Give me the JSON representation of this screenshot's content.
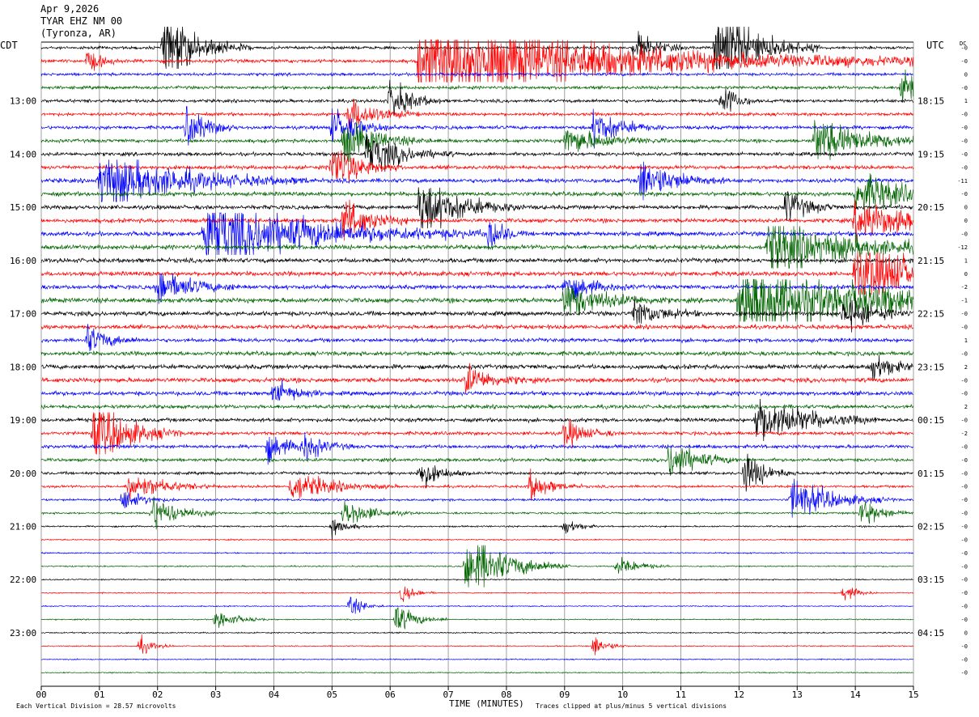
{
  "header": {
    "date": "Apr 9,2026",
    "station": "TYAR EHZ NM 00",
    "location": "(Tyronza, AR)"
  },
  "axis": {
    "left_zone": "CDT",
    "right_zone": "UTC",
    "dc_label": "DC",
    "xlabel": "TIME (MINUTES)"
  },
  "footer": {
    "scale_note": "Each Vertical Division =   28.57 microvolts",
    "clip_note": "Traces clipped at plus/minus 5 vertical divisions"
  },
  "chart_data": {
    "type": "line",
    "title": "TYAR EHZ NM 00",
    "xlabel": "TIME (MINUTES)",
    "xlim": [
      0,
      15
    ],
    "x_ticks": [
      "00",
      "01",
      "02",
      "03",
      "04",
      "05",
      "06",
      "07",
      "08",
      "09",
      "10",
      "11",
      "12",
      "13",
      "14",
      "15"
    ],
    "trace_colors": [
      "#000000",
      "#ff0000",
      "#0000ff",
      "#006400"
    ],
    "trace_count": 48,
    "left_ticks": [
      {
        "trace": 4,
        "label": "13:00"
      },
      {
        "trace": 8,
        "label": "14:00"
      },
      {
        "trace": 12,
        "label": "15:00"
      },
      {
        "trace": 16,
        "label": "16:00"
      },
      {
        "trace": 20,
        "label": "17:00"
      },
      {
        "trace": 24,
        "label": "18:00"
      },
      {
        "trace": 28,
        "label": "19:00"
      },
      {
        "trace": 32,
        "label": "20:00"
      },
      {
        "trace": 36,
        "label": "21:00"
      },
      {
        "trace": 40,
        "label": "22:00"
      },
      {
        "trace": 44,
        "label": "23:00"
      }
    ],
    "right_ticks": [
      {
        "trace": 4,
        "label": "18:15"
      },
      {
        "trace": 8,
        "label": "19:15"
      },
      {
        "trace": 12,
        "label": "20:15"
      },
      {
        "trace": 16,
        "label": "21:15"
      },
      {
        "trace": 20,
        "label": "22:15"
      },
      {
        "trace": 24,
        "label": "23:15"
      },
      {
        "trace": 28,
        "label": "00:15"
      },
      {
        "trace": 32,
        "label": "01:15"
      },
      {
        "trace": 36,
        "label": "02:15"
      },
      {
        "trace": 40,
        "label": "03:15"
      },
      {
        "trace": 44,
        "label": "04:15"
      }
    ],
    "dc_offsets": [
      "-0",
      "-0",
      "0",
      "-0",
      "1",
      "-0",
      "-0",
      "-0",
      "-0",
      "-0",
      "-11",
      "-0",
      "0",
      "0",
      "-0",
      "-12",
      "1",
      "0",
      "-2",
      "-1",
      "-0",
      "-0",
      "1",
      "-0",
      "2",
      "-0",
      "-0",
      "2",
      "-0",
      "-2",
      "-0",
      "-0",
      "-0",
      "-0",
      "-0",
      "-0",
      "-0",
      "-0",
      "-0",
      "-0",
      "-0",
      "-0",
      "-0",
      "-0",
      "0",
      "-0",
      "-0",
      "-0"
    ],
    "noise_level": [
      0.9,
      1.1,
      0.9,
      1.0,
      1.0,
      1.0,
      1.1,
      1.1,
      1.1,
      1.2,
      1.3,
      1.3,
      1.3,
      1.3,
      1.4,
      1.4,
      1.4,
      1.4,
      1.3,
      1.5,
      1.4,
      1.3,
      1.2,
      1.3,
      1.4,
      1.4,
      1.3,
      1.2,
      1.2,
      1.1,
      1.1,
      1.0,
      0.9,
      0.8,
      0.7,
      0.6,
      0.5,
      0.4,
      0.4,
      0.4,
      0.4,
      0.35,
      0.35,
      0.35,
      0.4,
      0.35,
      0.35,
      0.35
    ],
    "events": [
      {
        "trace": 0,
        "minute": 2.1,
        "amp": 5,
        "dur": 0.5
      },
      {
        "trace": 1,
        "minute": 6.5,
        "amp": 6,
        "dur": 3.0
      },
      {
        "trace": 1,
        "minute": 0.8,
        "amp": 1.5,
        "dur": 0.2
      },
      {
        "trace": 0,
        "minute": 11.6,
        "amp": 6,
        "dur": 0.6
      },
      {
        "trace": 0,
        "minute": 10.2,
        "amp": 2.5,
        "dur": 0.3
      },
      {
        "trace": 3,
        "minute": 14.8,
        "amp": 4,
        "dur": 0.2
      },
      {
        "trace": 4,
        "minute": 6.0,
        "amp": 3,
        "dur": 0.3
      },
      {
        "trace": 4,
        "minute": 11.7,
        "amp": 3,
        "dur": 0.2
      },
      {
        "trace": 5,
        "minute": 5.3,
        "amp": 2.5,
        "dur": 0.4
      },
      {
        "trace": 6,
        "minute": 2.5,
        "amp": 3,
        "dur": 0.3
      },
      {
        "trace": 6,
        "minute": 5.0,
        "amp": 2.5,
        "dur": 0.4
      },
      {
        "trace": 6,
        "minute": 9.5,
        "amp": 2.5,
        "dur": 0.4
      },
      {
        "trace": 7,
        "minute": 5.2,
        "amp": 3,
        "dur": 0.5
      },
      {
        "trace": 7,
        "minute": 9.0,
        "amp": 2,
        "dur": 0.6
      },
      {
        "trace": 7,
        "minute": 13.3,
        "amp": 3,
        "dur": 0.8
      },
      {
        "trace": 8,
        "minute": 5.6,
        "amp": 3,
        "dur": 0.5
      },
      {
        "trace": 9,
        "minute": 5.0,
        "amp": 3.5,
        "dur": 0.4
      },
      {
        "trace": 10,
        "minute": 1.0,
        "amp": 4,
        "dur": 1.2
      },
      {
        "trace": 10,
        "minute": 10.3,
        "amp": 3,
        "dur": 0.5
      },
      {
        "trace": 11,
        "minute": 14.0,
        "amp": 3,
        "dur": 0.8
      },
      {
        "trace": 12,
        "minute": 6.5,
        "amp": 4,
        "dur": 0.6
      },
      {
        "trace": 12,
        "minute": 12.8,
        "amp": 2.5,
        "dur": 0.3
      },
      {
        "trace": 13,
        "minute": 14.0,
        "amp": 3,
        "dur": 0.8
      },
      {
        "trace": 13,
        "minute": 5.2,
        "amp": 3,
        "dur": 0.4
      },
      {
        "trace": 14,
        "minute": 2.8,
        "amp": 5,
        "dur": 1.6
      },
      {
        "trace": 14,
        "minute": 7.7,
        "amp": 3,
        "dur": 0.2
      },
      {
        "trace": 15,
        "minute": 12.5,
        "amp": 4,
        "dur": 1.2
      },
      {
        "trace": 17,
        "minute": 14.0,
        "amp": 4,
        "dur": 1.4
      },
      {
        "trace": 18,
        "minute": 2.0,
        "amp": 2.5,
        "dur": 0.5
      },
      {
        "trace": 18,
        "minute": 9.0,
        "amp": 2,
        "dur": 0.4
      },
      {
        "trace": 19,
        "minute": 12.0,
        "amp": 5,
        "dur": 2.2
      },
      {
        "trace": 19,
        "minute": 9.0,
        "amp": 2.5,
        "dur": 0.6
      },
      {
        "trace": 20,
        "minute": 10.2,
        "amp": 2,
        "dur": 0.4
      },
      {
        "trace": 20,
        "minute": 13.8,
        "amp": 2.5,
        "dur": 0.4
      },
      {
        "trace": 22,
        "minute": 0.8,
        "amp": 2,
        "dur": 0.3
      },
      {
        "trace": 24,
        "minute": 14.3,
        "amp": 2,
        "dur": 0.3
      },
      {
        "trace": 25,
        "minute": 7.3,
        "amp": 2,
        "dur": 0.4
      },
      {
        "trace": 26,
        "minute": 4.0,
        "amp": 2,
        "dur": 0.3
      },
      {
        "trace": 28,
        "minute": 12.3,
        "amp": 3.5,
        "dur": 0.7
      },
      {
        "trace": 29,
        "minute": 0.9,
        "amp": 5,
        "dur": 0.5
      },
      {
        "trace": 29,
        "minute": 9.0,
        "amp": 2,
        "dur": 0.3
      },
      {
        "trace": 30,
        "minute": 3.9,
        "amp": 2,
        "dur": 0.3
      },
      {
        "trace": 30,
        "minute": 4.5,
        "amp": 2,
        "dur": 0.3
      },
      {
        "trace": 31,
        "minute": 10.8,
        "amp": 3,
        "dur": 0.4
      },
      {
        "trace": 32,
        "minute": 6.5,
        "amp": 2,
        "dur": 0.3
      },
      {
        "trace": 32,
        "minute": 12.1,
        "amp": 3,
        "dur": 0.3
      },
      {
        "trace": 33,
        "minute": 1.5,
        "amp": 2,
        "dur": 0.5
      },
      {
        "trace": 33,
        "minute": 4.3,
        "amp": 2,
        "dur": 0.6
      },
      {
        "trace": 33,
        "minute": 8.4,
        "amp": 2,
        "dur": 0.3
      },
      {
        "trace": 34,
        "minute": 12.9,
        "amp": 3,
        "dur": 0.6
      },
      {
        "trace": 34,
        "minute": 1.4,
        "amp": 1.5,
        "dur": 0.3
      },
      {
        "trace": 35,
        "minute": 1.9,
        "amp": 2.5,
        "dur": 0.4
      },
      {
        "trace": 35,
        "minute": 5.2,
        "amp": 2,
        "dur": 0.4
      },
      {
        "trace": 35,
        "minute": 14.1,
        "amp": 2,
        "dur": 0.3
      },
      {
        "trace": 36,
        "minute": 5.0,
        "amp": 1.5,
        "dur": 0.2
      },
      {
        "trace": 36,
        "minute": 9.0,
        "amp": 1.2,
        "dur": 0.2
      },
      {
        "trace": 39,
        "minute": 7.3,
        "amp": 5,
        "dur": 0.6
      },
      {
        "trace": 39,
        "minute": 9.9,
        "amp": 1.5,
        "dur": 0.3
      },
      {
        "trace": 41,
        "minute": 6.2,
        "amp": 1.2,
        "dur": 0.2
      },
      {
        "trace": 41,
        "minute": 13.8,
        "amp": 1.2,
        "dur": 0.2
      },
      {
        "trace": 42,
        "minute": 5.3,
        "amp": 1.5,
        "dur": 0.2
      },
      {
        "trace": 43,
        "minute": 3.0,
        "amp": 1.5,
        "dur": 0.3
      },
      {
        "trace": 43,
        "minute": 6.1,
        "amp": 2,
        "dur": 0.3
      },
      {
        "trace": 45,
        "minute": 1.7,
        "amp": 1.2,
        "dur": 0.2
      },
      {
        "trace": 45,
        "minute": 9.5,
        "amp": 1.5,
        "dur": 0.2
      }
    ]
  }
}
